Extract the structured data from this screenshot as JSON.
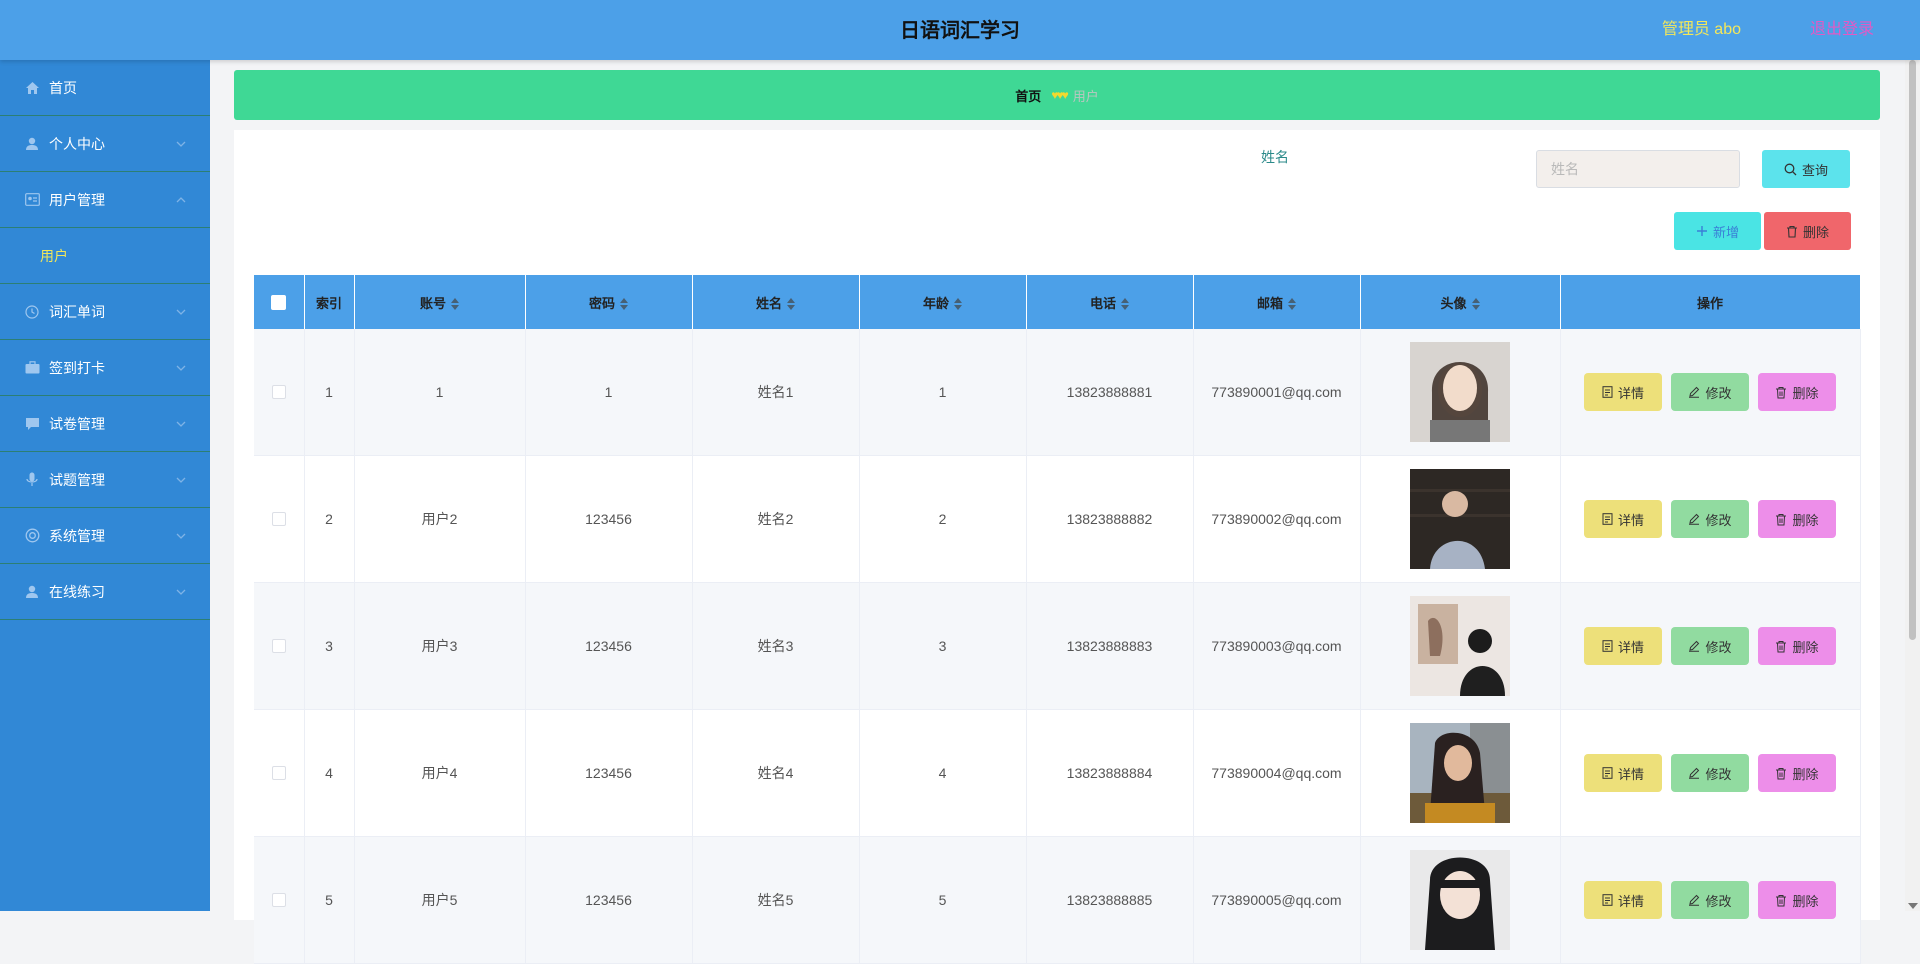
{
  "header": {
    "title": "日语词汇学习",
    "admin_label": "管理员 abo",
    "logout_label": "退出登录"
  },
  "colors": {
    "header_bg": "#4ca0e8",
    "sidebar_bg": "#3188d6",
    "breadcrumb_bg": "#3fd895",
    "highlight_yellow": "#f3e75a",
    "logout_pink": "#e25ac5"
  },
  "sidebar": {
    "items": [
      {
        "label": "首页",
        "icon": "home-icon",
        "has_chevron": false
      },
      {
        "label": "个人中心",
        "icon": "user-icon",
        "has_chevron": true
      },
      {
        "label": "用户管理",
        "icon": "id-card-icon",
        "has_chevron": true,
        "expanded": true,
        "children": [
          {
            "label": "用户"
          }
        ]
      },
      {
        "label": "词汇单词",
        "icon": "clock-icon",
        "has_chevron": true
      },
      {
        "label": "签到打卡",
        "icon": "briefcase-icon",
        "has_chevron": true
      },
      {
        "label": "试卷管理",
        "icon": "chat-icon",
        "has_chevron": true
      },
      {
        "label": "试题管理",
        "icon": "mic-icon",
        "has_chevron": true
      },
      {
        "label": "系统管理",
        "icon": "lifebuoy-icon",
        "has_chevron": true
      },
      {
        "label": "在线练习",
        "icon": "user-icon",
        "has_chevron": true
      }
    ]
  },
  "breadcrumb": {
    "home": "首页",
    "separator": "♥♥♥",
    "current": "用户"
  },
  "search": {
    "label": "姓名",
    "placeholder": "姓名",
    "value": "",
    "button_label": "查询"
  },
  "actions": {
    "add_label": "新增",
    "delete_label": "删除"
  },
  "table": {
    "headers": {
      "index": "索引",
      "account": "账号",
      "password": "密码",
      "name": "姓名",
      "age": "年龄",
      "phone": "电话",
      "email": "邮箱",
      "avatar": "头像",
      "ops": "操作"
    },
    "op_labels": {
      "detail": "详情",
      "edit": "修改",
      "delete": "删除"
    },
    "rows": [
      {
        "index": "1",
        "account": "1",
        "password": "1",
        "name": "姓名1",
        "age": "1",
        "phone": "13823888881",
        "email": "773890001@qq.com"
      },
      {
        "index": "2",
        "account": "用户2",
        "password": "123456",
        "name": "姓名2",
        "age": "2",
        "phone": "13823888882",
        "email": "773890002@qq.com"
      },
      {
        "index": "3",
        "account": "用户3",
        "password": "123456",
        "name": "姓名3",
        "age": "3",
        "phone": "13823888883",
        "email": "773890003@qq.com"
      },
      {
        "index": "4",
        "account": "用户4",
        "password": "123456",
        "name": "姓名4",
        "age": "4",
        "phone": "13823888884",
        "email": "773890004@qq.com"
      },
      {
        "index": "5",
        "account": "用户5",
        "password": "123456",
        "name": "姓名5",
        "age": "5",
        "phone": "13823888885",
        "email": "773890005@qq.com"
      }
    ]
  }
}
